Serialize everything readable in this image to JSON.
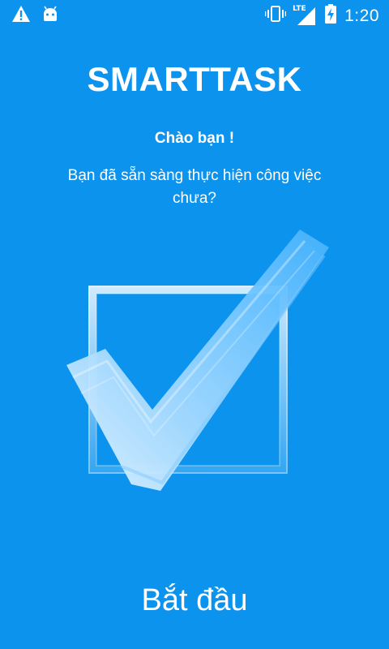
{
  "status_bar": {
    "time": "1:20",
    "network_label": "LTE",
    "icons": [
      "warning-icon",
      "android-icon",
      "vibrate-icon",
      "signal-icon",
      "battery-charging-icon"
    ]
  },
  "app": {
    "title": "SMARTTASK",
    "greeting": "Chào bạn !",
    "question": "Bạn đã sẵn sàng thực hiện công việc chưa?",
    "start_label": "Bắt đầu"
  },
  "hero": {
    "icon": "checkbox-check-icon"
  },
  "colors": {
    "background": "#0b93ee",
    "text": "#ffffff",
    "check_light": "#cfeaff"
  }
}
